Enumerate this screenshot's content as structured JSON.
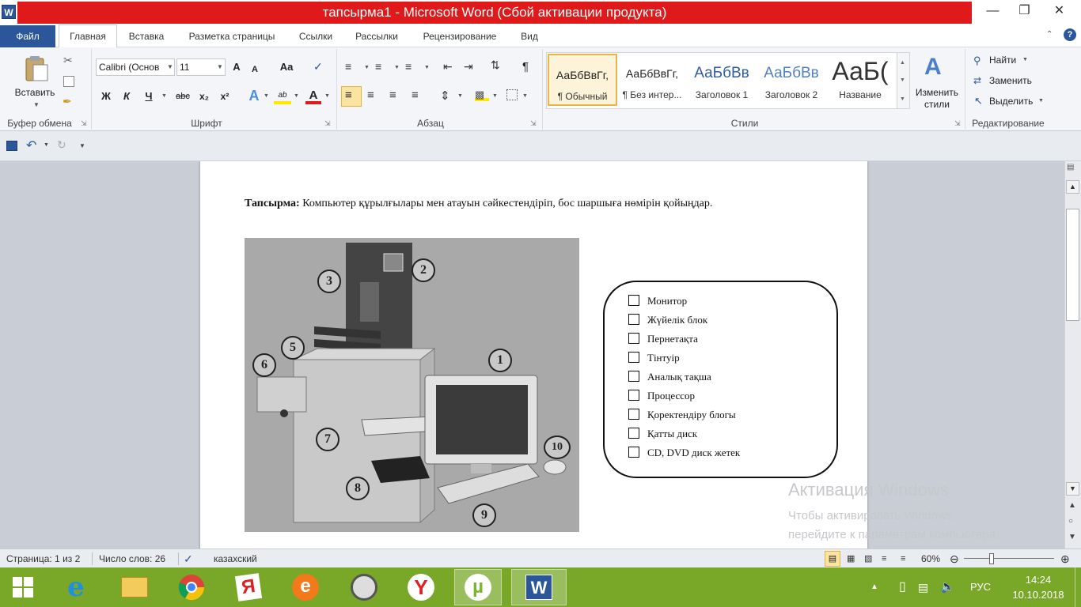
{
  "window": {
    "title": "тапсырма1  -  Microsoft Word (Сбой активации продукта)",
    "app_icon": "W",
    "controls": [
      "minimize-icon",
      "restore-icon",
      "close-icon"
    ]
  },
  "tabs": {
    "file": "Файл",
    "items": [
      "Главная",
      "Вставка",
      "Разметка страницы",
      "Ссылки",
      "Рассылки",
      "Рецензирование",
      "Вид"
    ],
    "active": "Главная"
  },
  "ribbon": {
    "clipboard": {
      "paste_label": "Вставить",
      "group_label": "Буфер обмена"
    },
    "font": {
      "font_name": "Calibri (Основ",
      "font_size": "11",
      "group_label": "Шрифт",
      "bold": "Ж",
      "italic": "К",
      "underline": "Ч",
      "strike": "abc",
      "sub": "x₂",
      "sup": "x²",
      "grow": "A",
      "shrink": "A",
      "case": "Aa",
      "highlight": "ab",
      "color": "A"
    },
    "paragraph": {
      "group_label": "Абзац",
      "pilcrow": "¶"
    },
    "styles": {
      "group_label": "Стили",
      "items": [
        {
          "sample": "АаБбВвГг,",
          "name": "¶ Обычный",
          "selected": true
        },
        {
          "sample": "АаБбВвГг,",
          "name": "¶ Без интер..."
        },
        {
          "sample": "АаБбВв",
          "name": "Заголовок 1"
        },
        {
          "sample": "АаБбВв",
          "name": "Заголовок 2"
        },
        {
          "sample": "АаБ(",
          "name": "Название"
        }
      ],
      "change_styles": "Изменить стили"
    },
    "editing": {
      "group_label": "Редактирование",
      "find": "Найти",
      "replace": "Заменить",
      "select": "Выделить"
    }
  },
  "document": {
    "task_bold": "Тапсырма:",
    "task_text": " Компьютер құрылғылары мен атауын сәйкестендіріп, бос шаршыға нөмірін қойыңдар.",
    "numbers": [
      "1",
      "2",
      "3",
      "5",
      "6",
      "7",
      "8",
      "9",
      "10"
    ],
    "checklist": [
      "Монитор",
      "Жүйелік блок",
      "Пернетақта",
      "Тінтуір",
      "Аналық тақша",
      "Процессор",
      "Қоректендіру блогы",
      "Қатты диск",
      "CD, DVD диск жетек"
    ]
  },
  "watermark": {
    "title": "Активация Windows",
    "line1": "Чтобы активировать Windows,",
    "line2": "перейдите к параметрам компьютера."
  },
  "status": {
    "page": "Страница: 1 из 2",
    "words": "Число слов: 26",
    "language": "казахский",
    "zoom": "60%"
  },
  "taskbar": {
    "lang": "РУС",
    "time": "14:24",
    "date": "10.10.2018"
  },
  "colors": {
    "accent": "#2b579a",
    "title_red": "#e01a1a",
    "taskbar": "#79a829"
  }
}
